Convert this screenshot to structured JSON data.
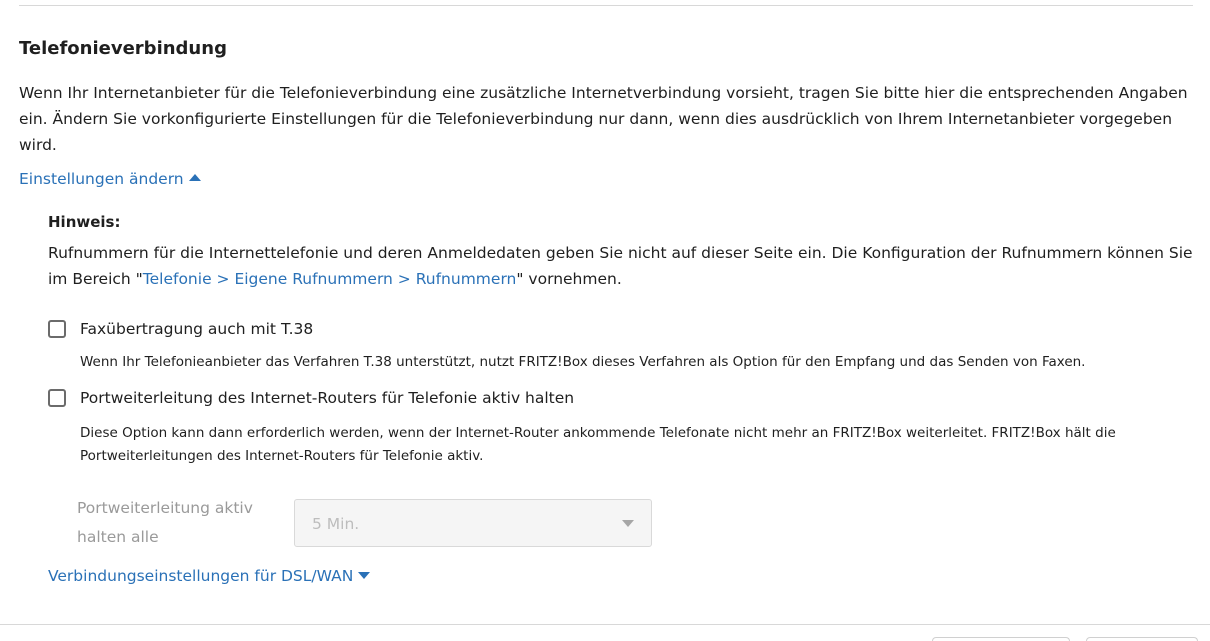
{
  "section": {
    "title": "Telefonieverbindung",
    "intro": "Wenn Ihr Internetanbieter für die Telefonieverbindung eine zusätzliche Internetverbindung vorsieht, tragen Sie bitte hier die entsprechenden Angaben ein. Ändern Sie vorkonfigurierte Einstellungen für die Telefonieverbindung nur dann, wenn dies ausdrücklich von Ihrem Internetanbieter vorgegeben wird.",
    "toggle_label": "Einstellungen ändern"
  },
  "hint": {
    "label": "Hinweis:",
    "text_before": "Rufnummern für die Internettelefonie und deren Anmeldedaten geben Sie nicht auf dieser Seite ein. Die Konfiguration der Rufnummern können Sie im Bereich \"",
    "link": "Telefonie > Eigene Rufnummern > Rufnummern",
    "text_after": "\" vornehmen."
  },
  "options": {
    "fax": {
      "label": "Faxübertragung auch mit T.38",
      "checked": false,
      "description": "Wenn Ihr Telefonieanbieter das Verfahren T.38 unterstützt, nutzt FRITZ!Box dieses Verfahren als Option für den Empfang und das Senden von Faxen."
    },
    "port": {
      "label": "Portweiterleitung des Internet-Routers für Telefonie aktiv halten",
      "checked": false,
      "description": "Diese Option kann dann erforderlich werden, wenn der Internet-Router ankommende Telefonate nicht mehr an FRITZ!Box weiterleitet. FRITZ!Box hält die Portweiterleitungen des Internet-Routers für Telefonie aktiv."
    }
  },
  "interval": {
    "label": "Portweiterleitung aktiv halten alle",
    "selected": "5 Min.",
    "disabled": true
  },
  "dsl_toggle_label": "Verbindungseinstellungen für DSL/WAN",
  "colors": {
    "link": "#2a71b7",
    "text": "#1f1f1f",
    "disabled_text": "#9a9a9a"
  }
}
